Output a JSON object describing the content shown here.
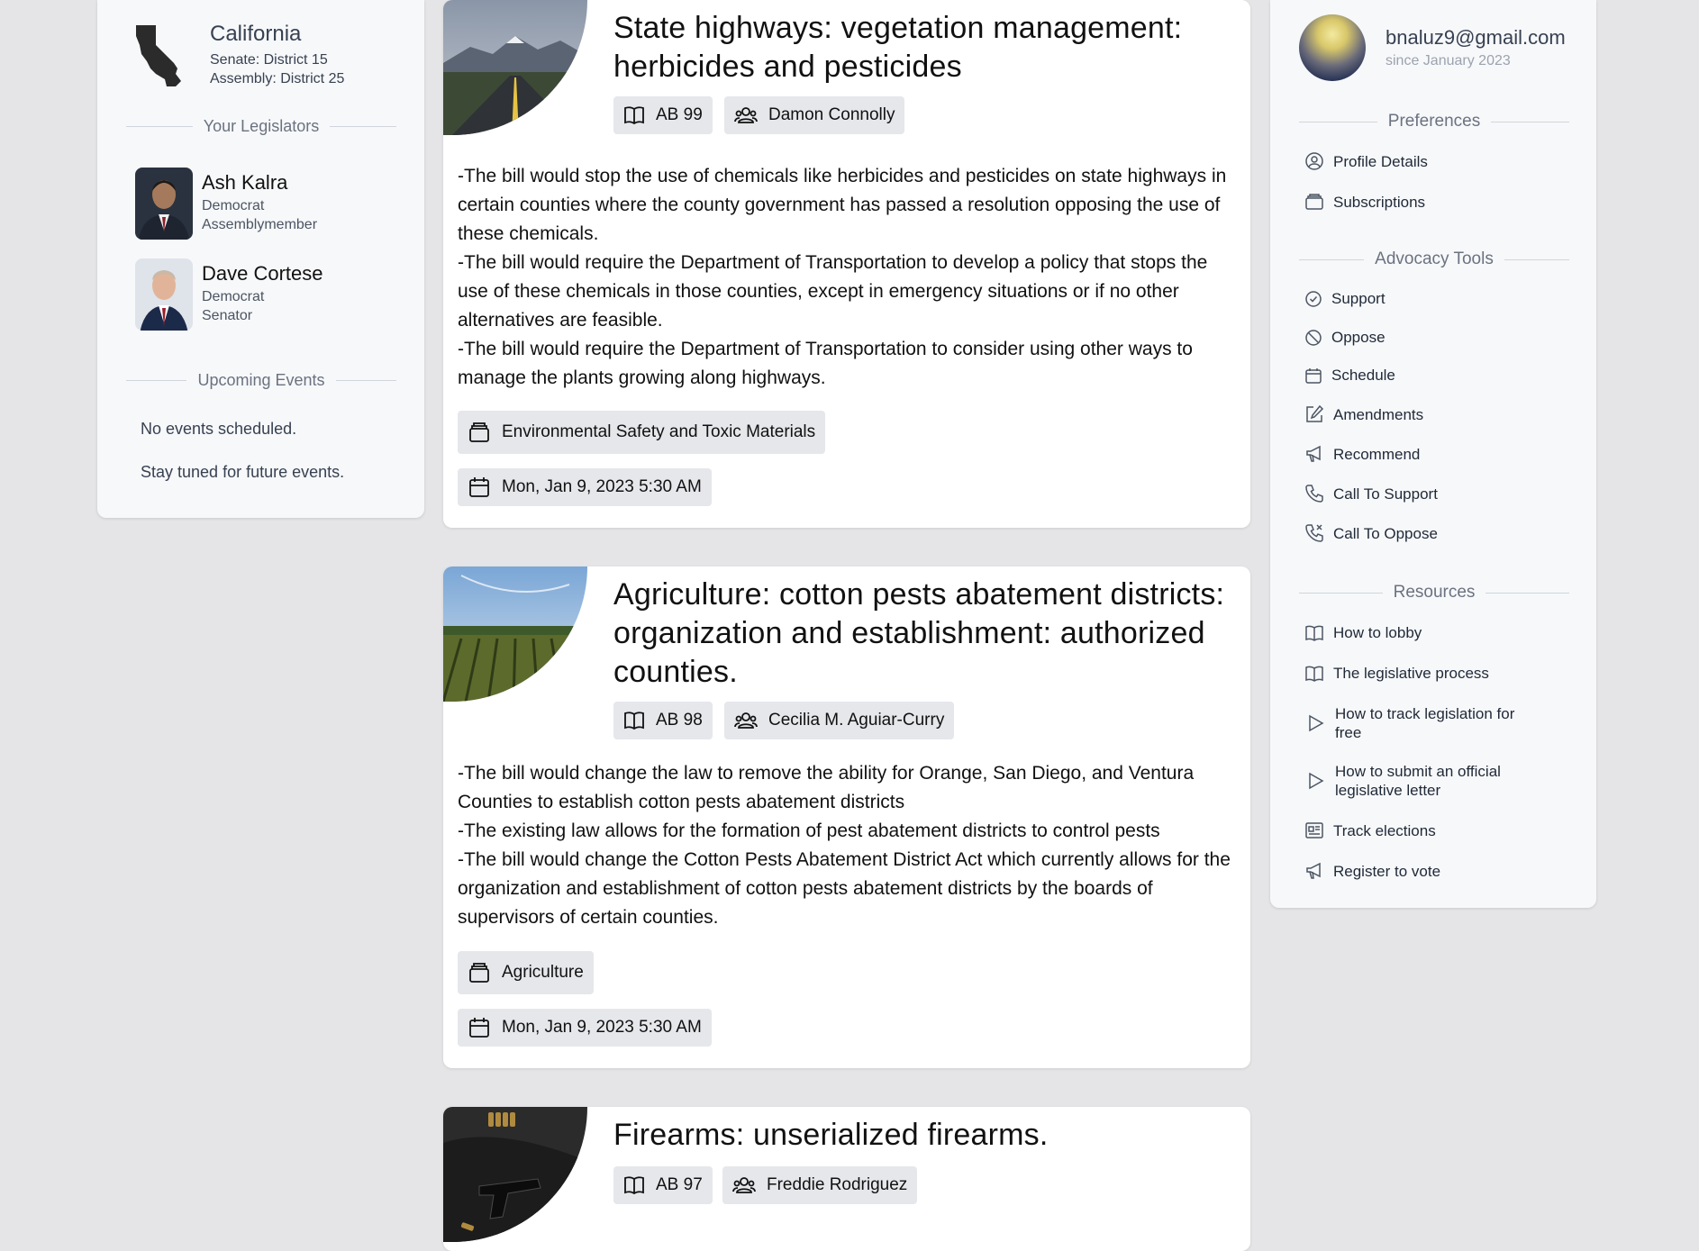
{
  "location": {
    "state": "California",
    "senate": "Senate: District 15",
    "assembly": "Assembly: District 25"
  },
  "legislators_heading": "Your Legislators",
  "legislators": [
    {
      "name": "Ash Kalra",
      "party": "Democrat",
      "role": "Assemblymember"
    },
    {
      "name": "Dave Cortese",
      "party": "Democrat",
      "role": "Senator"
    }
  ],
  "events": {
    "heading": "Upcoming Events",
    "none": "No events scheduled.",
    "tuned": "Stay tuned for future events."
  },
  "bills": [
    {
      "title": "State highways: vegetation management: herbicides and pesticides",
      "number": "AB 99",
      "author": "Damon Connolly",
      "summary": [
        "-The bill would stop the use of chemicals like herbicides and pesticides on state highways in certain counties where the county government has passed a resolution opposing the use of these chemicals.",
        "-The bill would require the Department of Transportation to develop a policy that stops the use of these chemicals in those counties, except in emergency situations or if no other alternatives are feasible.",
        "-The bill would require the Department of Transportation to consider using other ways to manage the plants growing along highways."
      ],
      "committee": "Environmental Safety and Toxic Materials",
      "date": "Mon, Jan 9, 2023 5:30 AM"
    },
    {
      "title": "Agriculture: cotton pests abatement districts: organization and establishment: authorized counties.",
      "number": "AB 98",
      "author": "Cecilia M. Aguiar-Curry",
      "summary": [
        "-The bill would change the law to remove the ability for Orange, San Diego, and Ventura Counties to establish cotton pests abatement districts",
        "-The existing law allows for the formation of pest abatement districts to control pests",
        "-The bill would change the Cotton Pests Abatement District Act which currently allows for the organization and establishment of cotton pests abatement districts by the boards of supervisors of certain counties."
      ],
      "committee": "Agriculture",
      "date": "Mon, Jan 9, 2023 5:30 AM"
    },
    {
      "title": "Firearms: unserialized firearms.",
      "number": "AB 97",
      "author": "Freddie Rodriguez"
    }
  ],
  "user": {
    "email": "bnaluz9@gmail.com",
    "since": "since January 2023"
  },
  "preferences": {
    "heading": "Preferences",
    "items": [
      "Profile Details",
      "Subscriptions"
    ]
  },
  "advocacy": {
    "heading": "Advocacy Tools",
    "items": [
      "Support",
      "Oppose",
      "Schedule",
      "Amendments",
      "Recommend",
      "Call To Support",
      "Call To Oppose"
    ]
  },
  "resources": {
    "heading": "Resources",
    "items": [
      "How to lobby",
      "The legislative process",
      "How to track legislation for free",
      "How to submit an official legislative letter",
      "Track elections",
      "Register to vote"
    ]
  }
}
